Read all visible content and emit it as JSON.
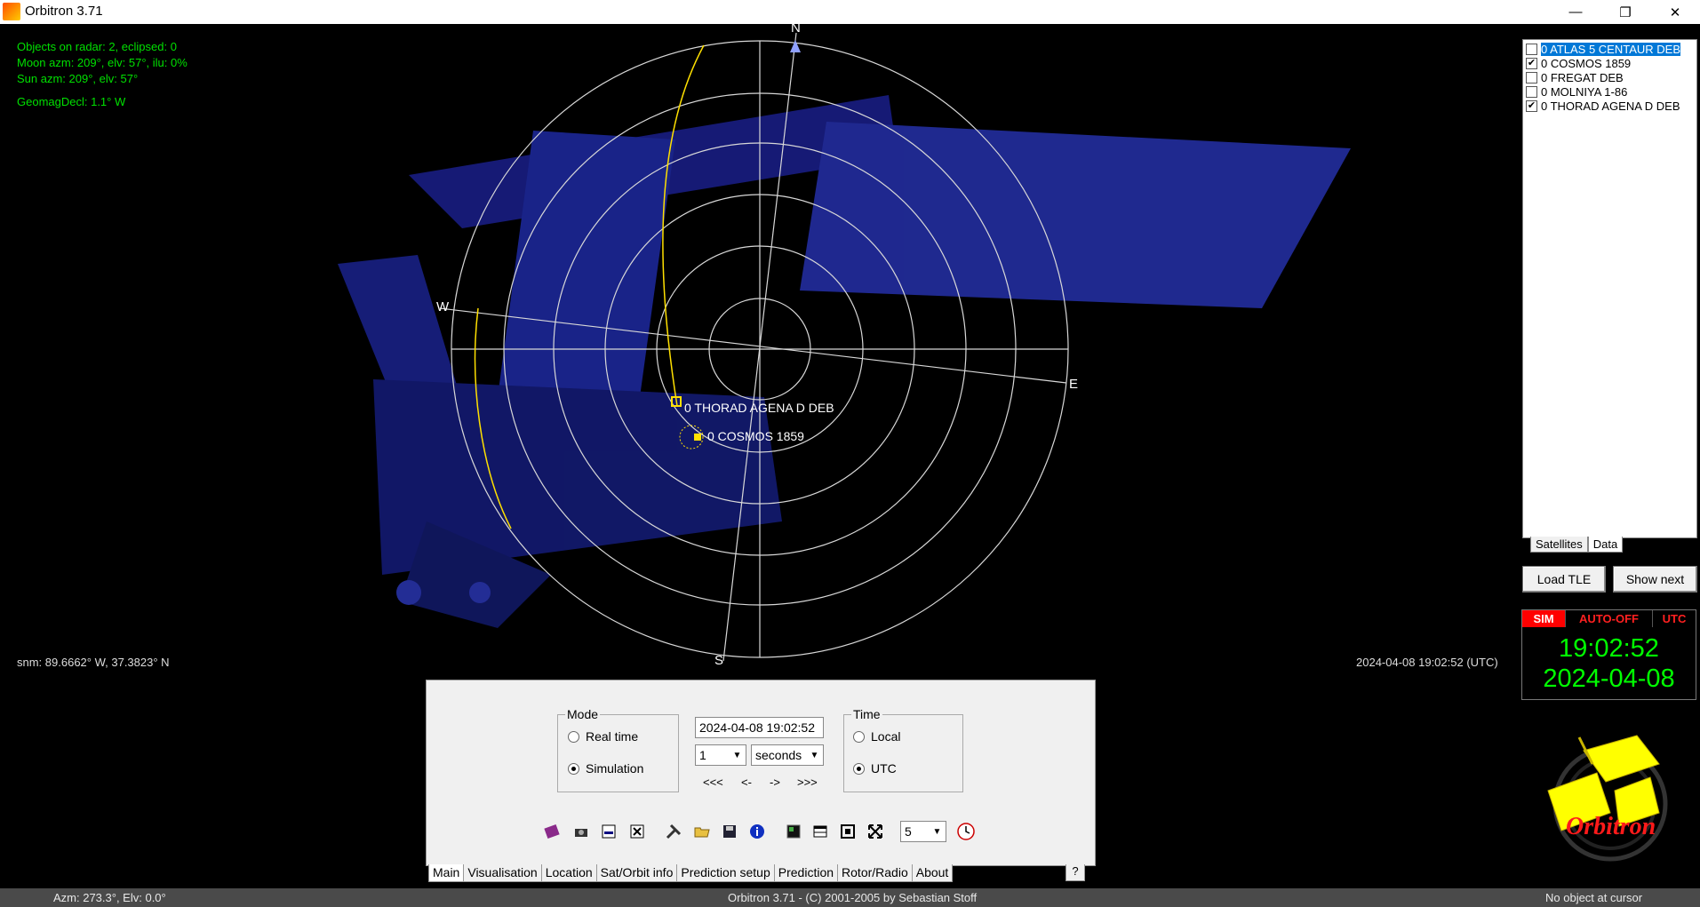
{
  "window": {
    "title": "Orbitron 3.71",
    "minimize": "—",
    "restore": "❐",
    "close": "✕"
  },
  "radar_info": {
    "objects": "Objects on radar: 2, eclipsed: 0",
    "moon": "Moon azm: 209°, elv: 57°, ilu: 0%",
    "sun": "Sun azm: 209°, elv: 57°",
    "geomag": "GeomagDecl: 1.1° W"
  },
  "compass": {
    "n": "N",
    "e": "E",
    "s": "S",
    "w": "W"
  },
  "radar_sats": [
    {
      "name": "0 THORAD AGENA D DEB"
    },
    {
      "name": "0 COSMOS 1859"
    }
  ],
  "location": "snm: 89.6662° W, 37.3823° N",
  "datetime_utc": "2024-04-08 19:02:52 (UTC)",
  "sat_list": [
    {
      "name": "0 ATLAS 5 CENTAUR DEB",
      "checked": false,
      "selected": true
    },
    {
      "name": "0 COSMOS 1859",
      "checked": true,
      "selected": false
    },
    {
      "name": "0 FREGAT DEB",
      "checked": false,
      "selected": false
    },
    {
      "name": "0 MOLNIYA 1-86",
      "checked": false,
      "selected": false
    },
    {
      "name": "0 THORAD AGENA D DEB",
      "checked": true,
      "selected": false
    }
  ],
  "right_tabs": {
    "satellites": "Satellites",
    "data": "Data"
  },
  "buttons": {
    "load_tle": "Load TLE",
    "show_next": "Show next"
  },
  "clock": {
    "sim": "SIM",
    "auto": "AUTO-OFF",
    "utc": "UTC",
    "time": "19:02:52",
    "date": "2024-04-08"
  },
  "logo_text": "Orbitron",
  "mode": {
    "legend": "Mode",
    "real_time": "Real time",
    "simulation": "Simulation",
    "selected": "simulation"
  },
  "sim_time": {
    "datetime": "2024-04-08 19:02:52",
    "step_value": "1",
    "step_unit": "seconds",
    "nav": [
      "<<<",
      "<-",
      "->",
      ">>>"
    ]
  },
  "time_group": {
    "legend": "Time",
    "local": "Local",
    "utc": "UTC",
    "selected": "utc"
  },
  "toolbar": {
    "count_value": "5",
    "icons": [
      "book-icon",
      "camera-icon",
      "minimize-window-icon",
      "close-window-icon",
      "tools-icon",
      "open-folder-icon",
      "save-icon",
      "info-icon",
      "map-icon",
      "window-icon",
      "fit-icon",
      "expand-icon",
      "clock-icon"
    ]
  },
  "tabs": [
    "Main",
    "Visualisation",
    "Location",
    "Sat/Orbit info",
    "Prediction setup",
    "Prediction",
    "Rotor/Radio",
    "About"
  ],
  "help": "?",
  "status": {
    "left": "Azm: 273.3°, Elv: 0.0°",
    "center": "Orbitron 3.71 - (C) 2001-2005 by Sebastian Stoff",
    "right": "No object at cursor"
  },
  "colors": {
    "green": "#00e000",
    "track": "#ffe000",
    "accent": "#0078d7",
    "sim_red": "#ff0000"
  }
}
